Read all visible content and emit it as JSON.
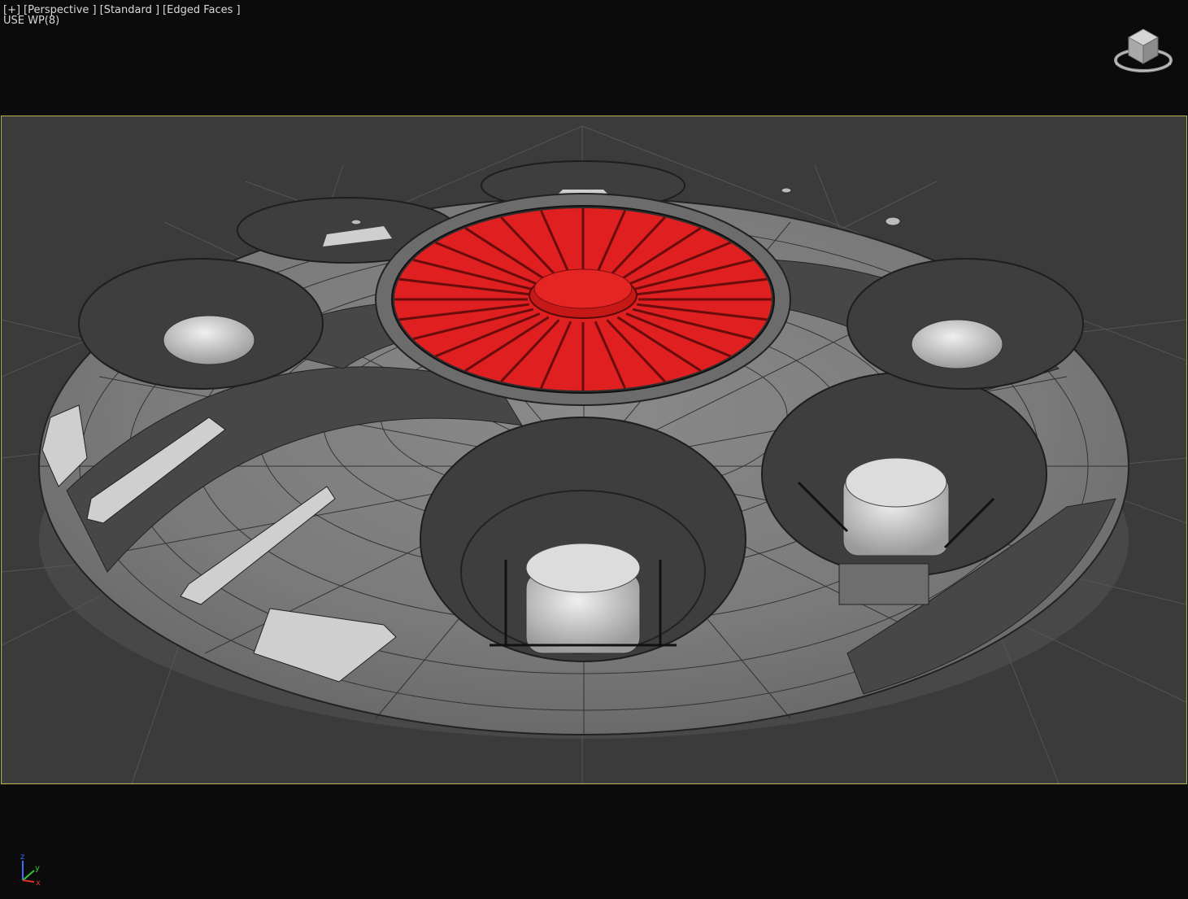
{
  "viewport": {
    "plus_menu": "[+]",
    "view_menu": "[Perspective ]",
    "shading_menu": "[Standard ]",
    "edged_faces_menu": "[Edged Faces ]",
    "statistics": "USE WP(8)"
  },
  "scene": {
    "object": "saucer-model",
    "highlight_color": "#e02020",
    "body_color": "#7e7e7e",
    "dark_panel_color": "#444444",
    "frame_color": "#b6b14a",
    "grid_color": "#5a5a5a"
  },
  "viewcube": {
    "icon": "viewcube-icon"
  },
  "axis_tripod": {
    "x": "x",
    "y": "y",
    "z": "z"
  }
}
